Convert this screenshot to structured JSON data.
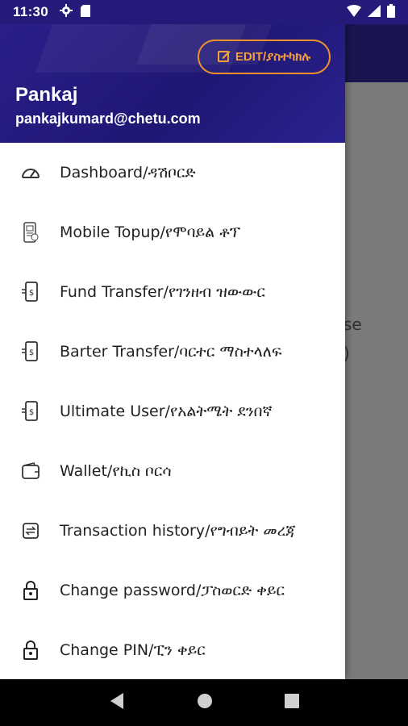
{
  "status": {
    "time": "11:30"
  },
  "header": {
    "edit_label": "EDIT/ያስተካክሉ",
    "user_name": "Pankaj",
    "user_email": "pankajkumard@chetu.com"
  },
  "menu": {
    "items": [
      {
        "label": "Dashboard/ዳሽቦርድ",
        "icon": "speedometer-icon"
      },
      {
        "label": "Mobile Topup/የሞባይል ቶፕ",
        "icon": "mobile-topup-icon"
      },
      {
        "label": "Fund Transfer/የገንዘብ ዝውውር",
        "icon": "money-transfer-icon"
      },
      {
        "label": "Barter Transfer/ባርተር ማስተላለፍ",
        "icon": "money-transfer-icon"
      },
      {
        "label": "Ultimate User/የአልትሜት ደንበኛ",
        "icon": "money-transfer-icon"
      },
      {
        "label": "Wallet/የኪስ ቦርሳ",
        "icon": "wallet-icon"
      },
      {
        "label": "Transaction history/የግብይት መረጃ",
        "icon": "transaction-history-icon"
      },
      {
        "label": "Change password/ፓስወርድ ቀይር",
        "icon": "lock-icon"
      },
      {
        "label": "Change PIN/ፒን ቀይር",
        "icon": "lock-icon"
      }
    ]
  },
  "background": {
    "text_line1": "se",
    "text_line2": ")"
  },
  "colors": {
    "header_bg": "#241a7a",
    "accent": "#f5a03a",
    "nav_bg": "#000000"
  }
}
